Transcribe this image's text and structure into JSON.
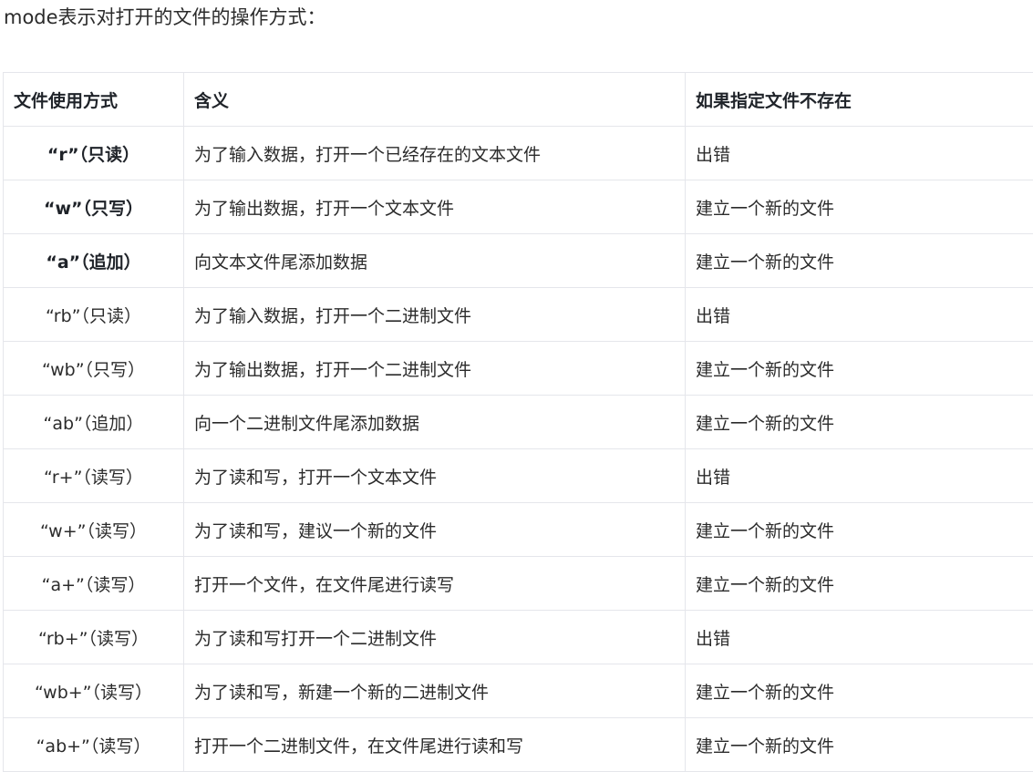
{
  "intro_text": "mode表示对打开的文件的操作方式：",
  "table": {
    "headers": [
      "文件使用方式",
      "含义",
      "如果指定文件不存在"
    ],
    "rows": [
      {
        "mode": "“r”（只读）",
        "meaning": "为了输入数据，打开一个已经存在的文本文件",
        "if_missing": "出错",
        "bold": true
      },
      {
        "mode": "“w”（只写）",
        "meaning": "为了输出数据，打开一个文本文件",
        "if_missing": "建立一个新的文件",
        "bold": true
      },
      {
        "mode": "“a”（追加）",
        "meaning": "向文本文件尾添加数据",
        "if_missing": "建立一个新的文件",
        "bold": true
      },
      {
        "mode": "“rb”（只读）",
        "meaning": "为了输入数据，打开一个二进制文件",
        "if_missing": "出错",
        "bold": false
      },
      {
        "mode": "“wb”（只写）",
        "meaning": "为了输出数据，打开一个二进制文件",
        "if_missing": "建立一个新的文件",
        "bold": false
      },
      {
        "mode": "“ab”（追加）",
        "meaning": "向一个二进制文件尾添加数据",
        "if_missing": "建立一个新的文件",
        "bold": false
      },
      {
        "mode": "“r+”（读写）",
        "meaning": "为了读和写，打开一个文本文件",
        "if_missing": "出错",
        "bold": false
      },
      {
        "mode": "“w+”（读写）",
        "meaning": "为了读和写，建议一个新的文件",
        "if_missing": "建立一个新的文件",
        "bold": false
      },
      {
        "mode": "“a+”（读写）",
        "meaning": "打开一个文件，在文件尾进行读写",
        "if_missing": "建立一个新的文件",
        "bold": false
      },
      {
        "mode": "“rb+”（读写）",
        "meaning": "为了读和写打开一个二进制文件",
        "if_missing": "出错",
        "bold": false
      },
      {
        "mode": "“wb+”（读写）",
        "meaning": "为了读和写，新建一个新的二进制文件",
        "if_missing": "建立一个新的文件",
        "bold": false
      },
      {
        "mode": "“ab+”（读写）",
        "meaning": "打开一个二进制文件，在文件尾进行读和写",
        "if_missing": "建立一个新的文件",
        "bold": false
      }
    ]
  }
}
